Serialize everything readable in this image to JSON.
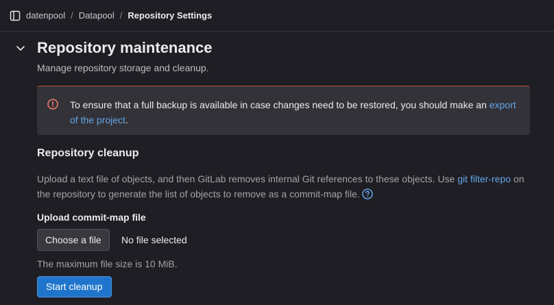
{
  "colors": {
    "background": "#1f1e24",
    "alert_background": "#333238",
    "alert_accent": "#c4583a",
    "link": "#63a6e9",
    "primary_button": "#1f75cb",
    "danger_icon": "#f57f6c"
  },
  "topbar": {
    "sidebar_toggle_icon": "sidebar-toggle-icon",
    "breadcrumb": [
      {
        "label": "datenpool"
      },
      {
        "label": "Datapool"
      },
      {
        "label": "Repository Settings"
      }
    ],
    "separator": "/"
  },
  "section": {
    "collapse_icon": "chevron-down-icon",
    "title": "Repository maintenance",
    "description": "Manage repository storage and cleanup."
  },
  "alert": {
    "icon": "error-circle-icon",
    "text_before": "To ensure that a full backup is available in case changes need to be restored, you should make an ",
    "link_text": "export of the project",
    "text_after": "."
  },
  "cleanup": {
    "title": "Repository cleanup",
    "description_before": "Upload a text file of objects, and then GitLab removes internal Git references to these objects. Use ",
    "link_text": "git filter-repo",
    "description_after": " on the repository to generate the list of objects to remove as a commit-map file.",
    "help_icon": "question-circle-icon",
    "upload_label": "Upload commit-map file",
    "choose_button": "Choose a file",
    "no_file_text": "No file selected",
    "max_size_text": "The maximum file size is 10 MiB.",
    "start_button": "Start cleanup"
  }
}
